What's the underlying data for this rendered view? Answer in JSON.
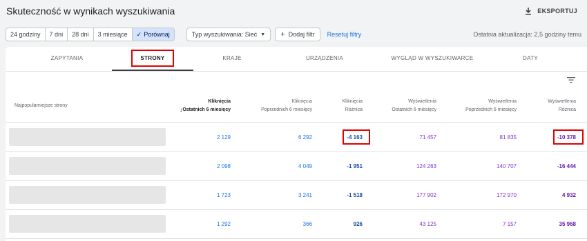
{
  "header": {
    "title": "Skuteczność w wynikach wyszukiwania",
    "export_label": "EKSPORTUJ"
  },
  "filters": {
    "ranges": [
      "24 godziny",
      "7 dni",
      "28 dni",
      "3 miesiące"
    ],
    "compare_label": "Porównaj",
    "search_type": "Typ wyszukiwania: Sieć",
    "add_filter": "Dodaj filtr",
    "reset": "Resetuj filtry",
    "last_update": "Ostatnia aktualizacja: 2,5 godziny temu"
  },
  "tabs": [
    "ZAPYTANIA",
    "STRONY",
    "KRAJE",
    "URZĄDZENIA",
    "WYGLĄD W WYSZUKIWARCE",
    "DATY"
  ],
  "active_tab": "STRONY",
  "table": {
    "first_col_header": "Najpopularniejsze strony",
    "headers": [
      {
        "line1": "Kliknięcia",
        "line2": "Ostatnich 6 miesięcy"
      },
      {
        "line1": "Kliknięcia",
        "line2": "Poprzednich 6 miesięcy"
      },
      {
        "line1": "Kliknięcia",
        "line2": "Różnica"
      },
      {
        "line1": "Wyświetlenia",
        "line2": "Ostatnich 6 miesięcy"
      },
      {
        "line1": "Wyświetlenia",
        "line2": "Poprzednich 6 miesięcy"
      },
      {
        "line1": "Wyświetlenia",
        "line2": "Różnica"
      }
    ],
    "rows": [
      [
        "2 129",
        "6 292",
        "-4 163",
        "71 457",
        "81 835",
        "-10 378"
      ],
      [
        "2 098",
        "4 049",
        "-1 951",
        "124 263",
        "140 707",
        "-16 444"
      ],
      [
        "1 723",
        "3 241",
        "-1 518",
        "177 902",
        "172 970",
        "4 932"
      ],
      [
        "1 292",
        "366",
        "926",
        "43 125",
        "7 157",
        "35 968"
      ]
    ]
  },
  "colors": {
    "clicks": "#1a73e8",
    "clicks_diff": "#174ea6",
    "impressions": "#8430ce",
    "impressions_diff": "#681da8",
    "highlight": "#e00000"
  }
}
